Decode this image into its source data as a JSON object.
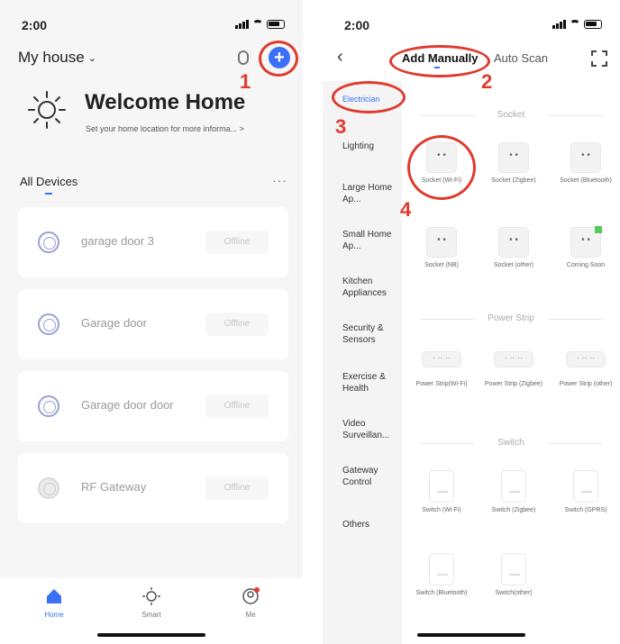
{
  "left": {
    "status_time": "2:00",
    "house_name": "My house",
    "welcome_title": "Welcome Home",
    "welcome_sub": "Set your home location for more informa...",
    "all_devices_label": "All Devices",
    "more_label": "···",
    "step_1": "1",
    "devices": [
      {
        "name": "garage door 3",
        "status": "Offline"
      },
      {
        "name": "Garage door",
        "status": "Offline"
      },
      {
        "name": "Garage door door",
        "status": "Offline"
      },
      {
        "name": "RF Gateway",
        "status": "Offline"
      }
    ],
    "tabs": [
      {
        "label": "Home",
        "icon": "home-icon"
      },
      {
        "label": "Smart",
        "icon": "smart-icon"
      },
      {
        "label": "Me",
        "icon": "me-icon"
      }
    ]
  },
  "right": {
    "status_time": "2:00",
    "tab_add": "Add Manually",
    "tab_auto": "Auto Scan",
    "step_2": "2",
    "step_3": "3",
    "step_4": "4",
    "categories": [
      "Electrician",
      "Lighting",
      "Large Home Ap...",
      "Small Home Ap...",
      "Kitchen Appliances",
      "Security & Sensors",
      "Exercise & Health",
      "Video Surveillan...",
      "Gateway Control",
      "Others"
    ],
    "sections": {
      "socket": "Socket",
      "power_strip": "Power Strip",
      "switch": "Switch"
    },
    "sockets": [
      "Socket (Wi-Fi)",
      "Socket (Zigbee)",
      "Socket (Bluetooth)",
      "Socket (NB)",
      "Socket (other)",
      "Coming Soon"
    ],
    "strips": [
      "Power Strip(Wi-Fi)",
      "Power Strip (Zigbee)",
      "Power Strip (other)"
    ],
    "switches": [
      "Switch (Wi-Fi)",
      "Switch (Zigbee)",
      "Switch (GPRS)",
      "Switch (Bluetooth)",
      "Switch(other)"
    ]
  },
  "colors": {
    "accent": "#3b6ff5",
    "annotation": "#e0392e",
    "badge": "#5ac85a"
  }
}
